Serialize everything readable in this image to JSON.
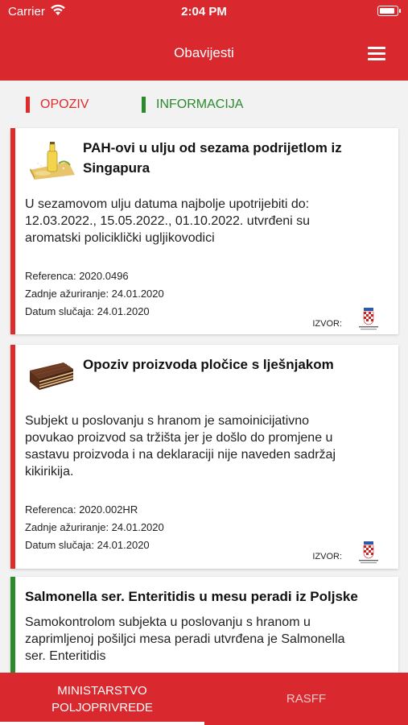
{
  "status": {
    "carrier": "Carrier",
    "time": "2:04 PM"
  },
  "header": {
    "title": "Obavijesti"
  },
  "filters": {
    "recall": "OPOZIV",
    "info": "INFORMACIJA"
  },
  "cards": [
    {
      "title_l1": "PAH-ovi u ulju od sezama podrijetlom iz",
      "title_l2": "Singapura",
      "desc_l1": "U sezamovom ulju datuma najbolje upotrijebiti do:",
      "desc_l2": "12.03.2022., 15.05.2022., 01.10.2022. utvrđeni su",
      "desc_l3": "aromatski policiklički ugljikovodici",
      "ref": "Referenca: 2020.0496",
      "updated": "Zadnje ažuriranje: 24.01.2020",
      "date": "Datum slučaja: 24.01.2020",
      "source": "IZVOR:",
      "source_logo_text": "MINISTARSTVO POLJOPRIVREDE"
    },
    {
      "title_l1": "Opoziv proizvoda pločice s lješnjakom",
      "desc_l1": "Subjekt u poslovanju s hranom je samoinicijativno",
      "desc_l2": "povukao proizvod sa tržišta jer je došlo do promjene u",
      "desc_l3": "sastavu proizvoda i na deklaraciji nije naveden sadržaj",
      "desc_l4": "kikirikija.",
      "ref": "Referenca: 2020.002HR",
      "updated": "Zadnje ažuriranje: 24.01.2020",
      "date": "Datum slučaja: 24.01.2020",
      "source": "IZVOR:",
      "source_logo_text": "MINISTARSTVO POLJOPRIVREDE"
    },
    {
      "title_l1": "Salmonella ser. Enteritidis u mesu peradi iz Poljske",
      "desc_l1": "Samokontrolom subjekta u poslovanju s hranom u",
      "desc_l2": "zaprimljenoj pošiljci mesa peradi utvrđena je Salmonella",
      "desc_l3": "ser. Enteritidis"
    }
  ],
  "tabs": {
    "t1_l1": "MINISTARSTVO",
    "t1_l2": "POLJOPRIVREDE",
    "t2": "RASFF"
  },
  "colors": {
    "brand": "#d9292f",
    "recall": "#e12a2a",
    "info": "#2c8a2c"
  }
}
